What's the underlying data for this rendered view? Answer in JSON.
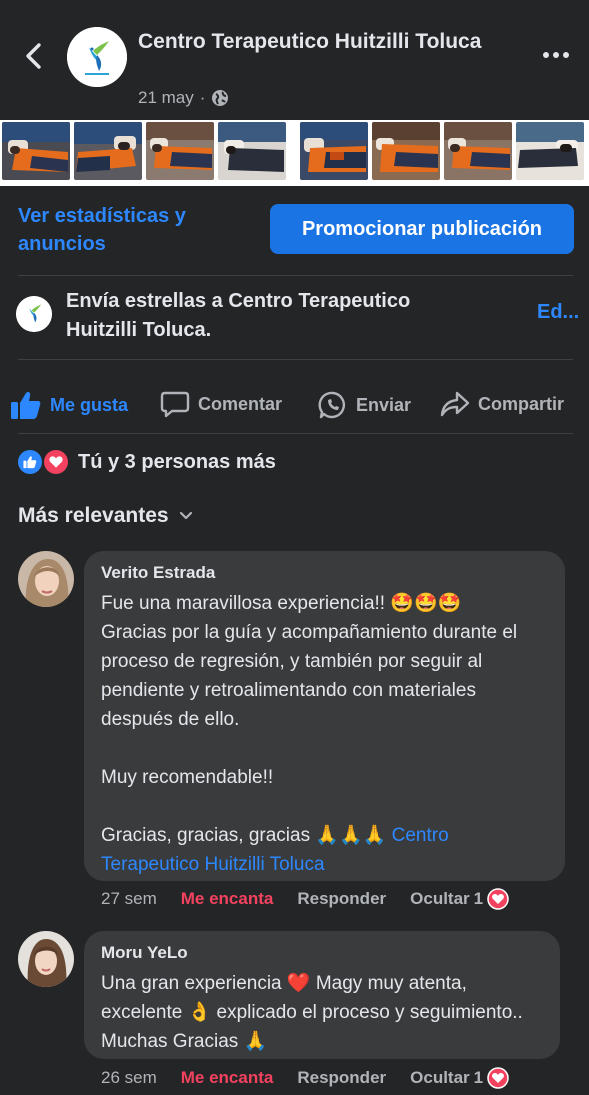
{
  "header": {
    "page_name": "Centro Terapeutico Huitzilli Toluca",
    "date": "21 may",
    "separator": "·",
    "audience_icon": "globe-icon"
  },
  "photos": {
    "count_left": 4,
    "count_right": 4
  },
  "post_actions": {
    "stats_link": "Ver estadísticas y anuncios",
    "promote_button": "Promocionar publicación"
  },
  "stars": {
    "text": "Envía estrellas a Centro Terapeutico Huitzilli Toluca.",
    "edit": "Ed..."
  },
  "action_bar": {
    "like": "Me gusta",
    "comment": "Comentar",
    "send": "Enviar",
    "share": "Compartir"
  },
  "reactions": {
    "text": "Tú y 3 personas más"
  },
  "sort": {
    "label": "Más relevantes"
  },
  "comments": [
    {
      "author": "Verito Estrada",
      "text": "Fue una maravillosa experiencia!! 🤩🤩🤩\nGracias por la guía y acompañamiento durante el proceso de regresión, y también por seguir al pendiente y retroalimentando con materiales después de ello.\n\nMuy recomendable!!\n\nGracias, gracias, gracias 🙏🙏🙏 ",
      "mention": "Centro Terapeutico Huitzilli Toluca",
      "time": "27 sem",
      "reaction_label": "Me encanta",
      "reply": "Responder",
      "hide": "Ocultar",
      "reaction_count": "1"
    },
    {
      "author": "Moru YeLo",
      "text": "Una gran experiencia ❤️ Magy muy atenta, excelente 👌 explicado el proceso y seguimiento.. Muchas Gracias 🙏",
      "mention": "",
      "time": "26 sem",
      "reaction_label": "Me encanta",
      "reply": "Responder",
      "hide": "Ocultar",
      "reaction_count": "1"
    }
  ],
  "colors": {
    "background": "#242526",
    "bubble": "#3a3b3c",
    "accent": "#2d88ff",
    "promote": "#1b74e4",
    "love": "#f3425f"
  }
}
